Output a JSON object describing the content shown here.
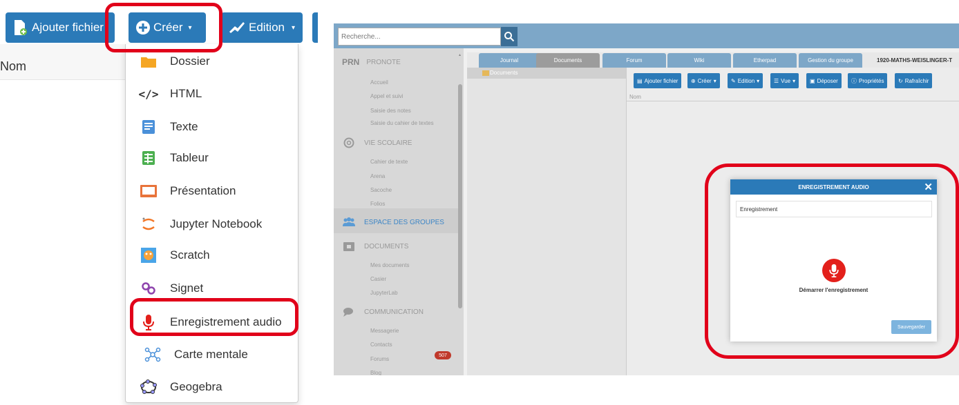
{
  "left": {
    "toolbar": {
      "add_file": "Ajouter fichier",
      "create": "Créer",
      "edition": "Edition"
    },
    "column_name": "Nom",
    "create_menu": [
      {
        "label": "Dossier",
        "icon": "folder-icon"
      },
      {
        "label": "HTML",
        "icon": "code-icon"
      },
      {
        "label": "Texte",
        "icon": "text-document-icon"
      },
      {
        "label": "Tableur",
        "icon": "spreadsheet-icon"
      },
      {
        "label": "Présentation",
        "icon": "presentation-icon"
      },
      {
        "label": "Jupyter Notebook",
        "icon": "jupyter-icon"
      },
      {
        "label": "Scratch",
        "icon": "scratch-icon"
      },
      {
        "label": "Signet",
        "icon": "bookmark-link-icon"
      },
      {
        "label": "Enregistrement audio",
        "icon": "microphone-icon"
      },
      {
        "label": "Carte mentale",
        "icon": "mind-map-icon"
      },
      {
        "label": "Geogebra",
        "icon": "geogebra-icon"
      }
    ]
  },
  "right": {
    "search": {
      "placeholder": "Recherche..."
    },
    "sidebar": {
      "sections": [
        {
          "title": "PRONOTE",
          "prefix": "PRN",
          "items": [
            "Accueil",
            "Appel et suivi",
            "Saisie des notes",
            "Saisie du cahier de textes"
          ]
        },
        {
          "title": "VIE SCOLAIRE",
          "icon": "life-ring-icon",
          "items": [
            "Cahier de texte",
            "Arena",
            "Sacoche",
            "Folios"
          ]
        },
        {
          "title": "ESPACE DES GROUPES",
          "icon": "group-icon",
          "items": []
        },
        {
          "title": "DOCUMENTS",
          "icon": "folder-icon",
          "items": [
            "Mes documents",
            "Casier",
            "JupyterLab"
          ]
        },
        {
          "title": "COMMUNICATION",
          "icon": "chat-icon",
          "items": [
            "Messagerie",
            "Contacts",
            "Forums",
            "Blog"
          ]
        }
      ],
      "messagerie_count": "507"
    },
    "tabs": [
      "Journal",
      "Documents",
      "Forum",
      "Wiki",
      "Etherpad",
      "Gestion du groupe"
    ],
    "group_title": "1920-MATHS-WEISLINGER-T",
    "tree_root": "Documents",
    "toolbar": [
      "Ajouter fichier",
      "Créer",
      "Edition",
      "Vue",
      "Déposer",
      "Propriétés",
      "Rafraîchir"
    ],
    "column_name": "Nom",
    "dialog": {
      "title": "ENREGISTREMENT AUDIO",
      "filename": "Enregistrement",
      "start_label": "Démarrer l'enregistrement",
      "save_label": "Sauvegarder"
    }
  },
  "colors": {
    "primary": "#2b7ab8",
    "highlight": "#e1001a",
    "record": "#e3201b"
  }
}
